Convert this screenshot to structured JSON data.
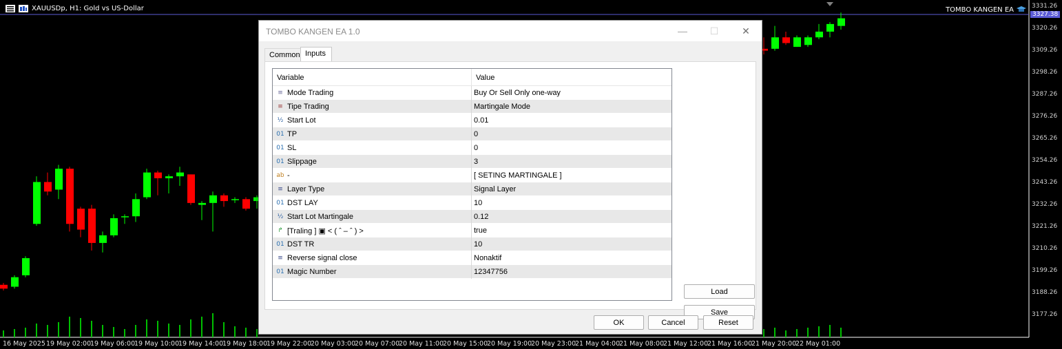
{
  "chart": {
    "symbol_text": "XAUUSDp, H1:  Gold vs US-Dollar",
    "ea_label": "TOMBO KANGEN EA",
    "current_price": "3327.38",
    "price_ticks": [
      "3331.26",
      "3320.26",
      "3309.26",
      "3298.26",
      "3287.26",
      "3276.26",
      "3265.26",
      "3254.26",
      "3243.26",
      "3232.26",
      "3221.26",
      "3210.26",
      "3199.26",
      "3188.26",
      "3177.26"
    ],
    "time_ticks": [
      "16 May 2025",
      "19 May 02:00",
      "19 May 06:00",
      "19 May 10:00",
      "19 May 14:00",
      "19 May 18:00",
      "19 May 22:00",
      "20 May 03:00",
      "20 May 07:00",
      "20 May 11:00",
      "20 May 15:00",
      "20 May 19:00",
      "20 May 23:00",
      "21 May 04:00",
      "21 May 08:00",
      "21 May 12:00",
      "21 May 16:00",
      "21 May 20:00",
      "22 May 01:00"
    ],
    "colors": {
      "bull": "#00ff00",
      "bear": "#ff0000",
      "current_line": "#5b5bd6",
      "volume": "#00c000"
    }
  },
  "chart_data": {
    "type": "candlestick",
    "title": "XAUUSDp, H1:  Gold vs US-Dollar",
    "ylim": [
      3172,
      3334
    ],
    "candles_left": [
      {
        "o": 3188,
        "h": 3189,
        "l": 3185,
        "c": 3186
      },
      {
        "o": 3187,
        "h": 3193,
        "l": 3186,
        "c": 3192
      },
      {
        "o": 3193,
        "h": 3203,
        "l": 3192,
        "c": 3202
      },
      {
        "o": 3220,
        "h": 3245,
        "l": 3219,
        "c": 3242
      },
      {
        "o": 3242,
        "h": 3247,
        "l": 3235,
        "c": 3237
      },
      {
        "o": 3238,
        "h": 3251,
        "l": 3233,
        "c": 3249
      },
      {
        "o": 3249,
        "h": 3250,
        "l": 3216,
        "c": 3220
      },
      {
        "o": 3228,
        "h": 3229,
        "l": 3213,
        "c": 3217
      },
      {
        "o": 3228,
        "h": 3230,
        "l": 3206,
        "c": 3210
      },
      {
        "o": 3210,
        "h": 3216,
        "l": 3205,
        "c": 3214
      },
      {
        "o": 3214,
        "h": 3225,
        "l": 3213,
        "c": 3223
      },
      {
        "o": 3224,
        "h": 3225,
        "l": 3220,
        "c": 3224
      },
      {
        "o": 3224,
        "h": 3236,
        "l": 3221,
        "c": 3233
      },
      {
        "o": 3234,
        "h": 3249,
        "l": 3233,
        "c": 3247
      },
      {
        "o": 3247,
        "h": 3248,
        "l": 3235,
        "c": 3244
      },
      {
        "o": 3244,
        "h": 3246,
        "l": 3236,
        "c": 3245
      },
      {
        "o": 3245,
        "h": 3250,
        "l": 3240,
        "c": 3247
      },
      {
        "o": 3246,
        "h": 3246,
        "l": 3230,
        "c": 3231
      },
      {
        "o": 3230,
        "h": 3232,
        "l": 3222,
        "c": 3231
      },
      {
        "o": 3231,
        "h": 3237,
        "l": 3216,
        "c": 3235
      },
      {
        "o": 3235,
        "h": 3236,
        "l": 3229,
        "c": 3232
      },
      {
        "o": 3233,
        "h": 3234,
        "l": 3231,
        "c": 3233
      },
      {
        "o": 3233,
        "h": 3234,
        "l": 3227,
        "c": 3228
      },
      {
        "o": 3232,
        "h": 3235,
        "l": 3228,
        "c": 3234
      }
    ],
    "candles_right": [
      {
        "o": 3312,
        "h": 3318,
        "l": 3309,
        "c": 3311
      },
      {
        "o": 3312,
        "h": 3324,
        "l": 3311,
        "c": 3318
      },
      {
        "o": 3318,
        "h": 3321,
        "l": 3314,
        "c": 3315
      },
      {
        "o": 3313,
        "h": 3319,
        "l": 3313,
        "c": 3318
      },
      {
        "o": 3314,
        "h": 3319,
        "l": 3313,
        "c": 3318
      },
      {
        "o": 3318,
        "h": 3325,
        "l": 3317,
        "c": 3321
      },
      {
        "o": 3321,
        "h": 3326,
        "l": 3318,
        "c": 3325
      },
      {
        "o": 3324,
        "h": 3331,
        "l": 3322,
        "c": 3328
      }
    ],
    "volumes_left": [
      10,
      12,
      14,
      20,
      18,
      22,
      30,
      28,
      24,
      18,
      15,
      12,
      18,
      26,
      24,
      20,
      18,
      26,
      30,
      35,
      22,
      16,
      14,
      12
    ],
    "volumes_right": [
      12,
      14,
      10,
      12,
      14,
      16,
      18,
      14
    ]
  },
  "dialog": {
    "title": "TOMBO KANGEN EA 1.0",
    "tabs": [
      "Common",
      "Inputs"
    ],
    "grid": {
      "col_variable": "Variable",
      "col_value": "Value",
      "rows": [
        {
          "icon": "≡",
          "icon_color": "#6a6a9a",
          "name": "Mode Trading",
          "value": "Buy Or Sell Only one-way"
        },
        {
          "icon": "≡",
          "icon_color": "#9a3a3a",
          "name": "Tipe Trading",
          "value": "Martingale Mode"
        },
        {
          "icon": "½",
          "icon_color": "#2a5fa0",
          "name": "Start Lot",
          "value": "0.01"
        },
        {
          "icon": "01",
          "icon_color": "#2a6fb0",
          "name": "TP",
          "value": "0"
        },
        {
          "icon": "01",
          "icon_color": "#2a6fb0",
          "name": "SL",
          "value": "0"
        },
        {
          "icon": "01",
          "icon_color": "#2a6fb0",
          "name": "Slippage",
          "value": "3"
        },
        {
          "icon": "ab",
          "icon_color": "#c08020",
          "name": "-",
          "value": "[ SETING MARTINGALE ]"
        },
        {
          "icon": "≡",
          "icon_color": "#3a4a8a",
          "name": "Layer Type",
          "value": "Signal Layer"
        },
        {
          "icon": "01",
          "icon_color": "#2a6fb0",
          "name": "DST LAY",
          "value": "10"
        },
        {
          "icon": "½",
          "icon_color": "#2a5fa0",
          "name": "Start Lot Martingale",
          "value": "0.12"
        },
        {
          "icon": "↱",
          "icon_color": "#2a9a3a",
          "name": "[Traling ] ▣ < ( ˆ – ˆ ) >",
          "value": "true"
        },
        {
          "icon": "01",
          "icon_color": "#2a6fb0",
          "name": "DST TR",
          "value": "10"
        },
        {
          "icon": "≡",
          "icon_color": "#3a4a8a",
          "name": "Reverse signal close",
          "value": "Nonaktif"
        },
        {
          "icon": "01",
          "icon_color": "#2a6fb0",
          "name": "Magic Number",
          "value": "12347756"
        }
      ]
    },
    "buttons": {
      "load": "Load",
      "save": "Save",
      "ok": "OK",
      "cancel": "Cancel",
      "reset": "Reset"
    },
    "window_controls": {
      "minimize": "—",
      "maximize": "☐",
      "close": "✕"
    }
  }
}
